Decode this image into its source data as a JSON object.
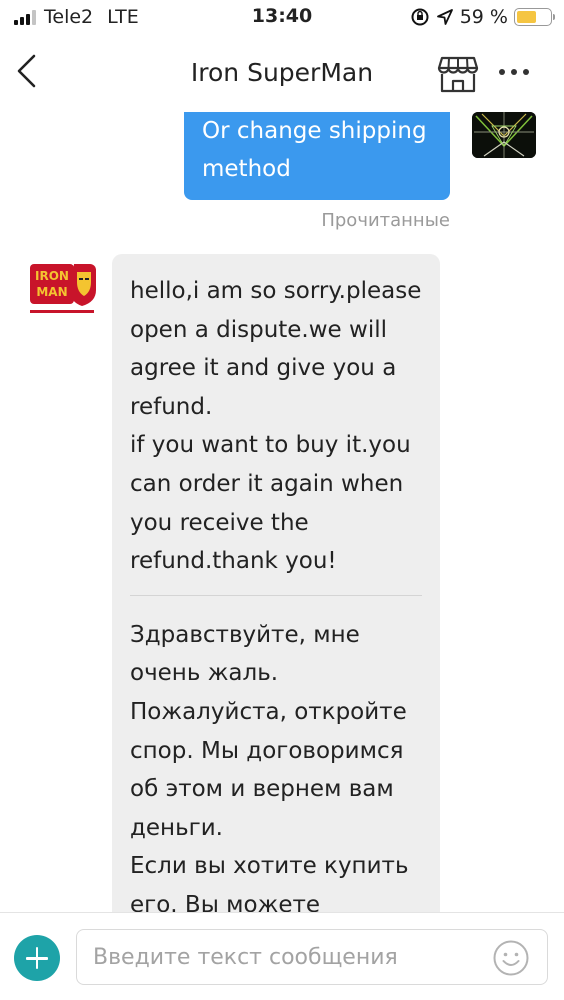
{
  "status_bar": {
    "carrier": "Tele2",
    "network": "LTE",
    "time": "13:40",
    "battery_text": "59 %",
    "battery_level": 0.59
  },
  "header": {
    "title": "Iron SuperMan"
  },
  "chat": {
    "outgoing": {
      "text": "Or change shipping method",
      "status": "Прочитанные"
    },
    "incoming": {
      "avatar_logo_lines": [
        "IRON",
        "MAN"
      ],
      "en_paragraph_1": "hello,i am so sorry.please open a dispute.we will agree it and give you a refund.",
      "en_paragraph_2": "if you want to buy it.you can order it again when you receive the refund.thank you!",
      "ru_paragraph_1": "Здравствуйте, мне очень жаль. Пожалуйста, откройте спор. Мы договоримся об этом и вернем вам деньги.",
      "ru_paragraph_2": "Если вы хотите купить его. Вы можете"
    }
  },
  "input": {
    "placeholder": "Введите текст сообщения",
    "value": ""
  },
  "colors": {
    "outgoing_bubble": "#3b99ee",
    "incoming_bubble": "#eeeeee",
    "add_button": "#1ea3a8",
    "battery": "#f5c542"
  }
}
